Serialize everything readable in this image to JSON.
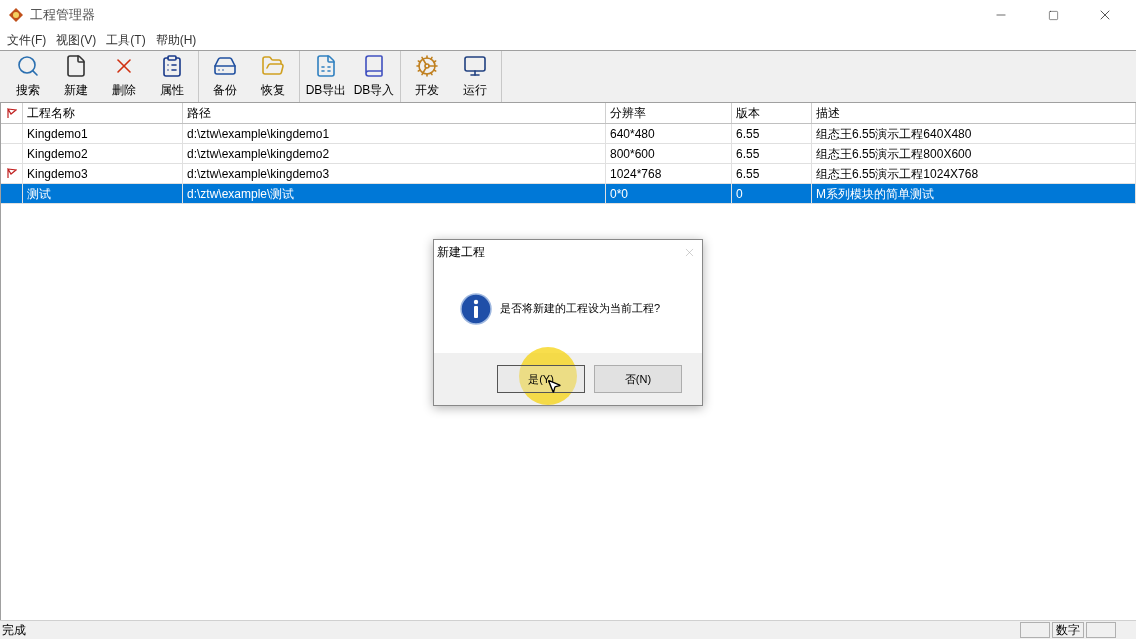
{
  "window": {
    "title": "工程管理器"
  },
  "menu": [
    "文件(F)",
    "视图(V)",
    "工具(T)",
    "帮助(H)"
  ],
  "toolbar": [
    [
      {
        "label": "搜索"
      },
      {
        "label": "新建"
      },
      {
        "label": "删除"
      },
      {
        "label": "属性"
      }
    ],
    [
      {
        "label": "备份"
      },
      {
        "label": "恢复"
      }
    ],
    [
      {
        "label": "DB导出"
      },
      {
        "label": "DB导入"
      }
    ],
    [
      {
        "label": "开发"
      },
      {
        "label": "运行"
      }
    ]
  ],
  "table": {
    "columns": [
      "工程名称",
      "路径",
      "分辨率",
      "版本",
      "描述"
    ],
    "rows": [
      {
        "cells": [
          "Kingdemo1",
          "d:\\ztw\\example\\kingdemo1",
          "640*480",
          "6.55",
          "组态王6.55演示工程640X480"
        ],
        "flagged": false,
        "selected": false
      },
      {
        "cells": [
          "Kingdemo2",
          "d:\\ztw\\example\\kingdemo2",
          "800*600",
          "6.55",
          "组态王6.55演示工程800X600"
        ],
        "flagged": false,
        "selected": false
      },
      {
        "cells": [
          "Kingdemo3",
          "d:\\ztw\\example\\kingdemo3",
          "1024*768",
          "6.55",
          "组态王6.55演示工程1024X768"
        ],
        "flagged": true,
        "selected": false
      },
      {
        "cells": [
          "测试",
          "d:\\ztw\\example\\测试",
          "0*0",
          "0",
          "M系列模块的简单测试"
        ],
        "flagged": false,
        "selected": true
      }
    ]
  },
  "dialog": {
    "title": "新建工程",
    "message": "是否将新建的工程设为当前工程?",
    "buttons": [
      "是(Y)",
      "否(N)"
    ]
  },
  "status_bar": {
    "text": "完成",
    "indicator": "数字"
  }
}
